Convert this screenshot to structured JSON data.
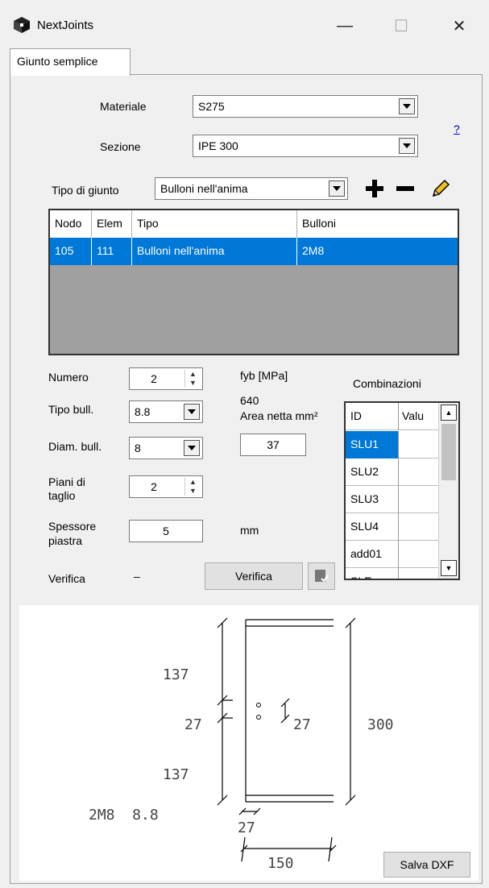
{
  "window": {
    "title": "NextJoints",
    "minimize": "—",
    "maximize": "☐",
    "close": "✕"
  },
  "tab": {
    "label": "Giunto semplice"
  },
  "form": {
    "materiale_label": "Materiale",
    "materiale_value": "S275",
    "sezione_label": "Sezione",
    "sezione_value": "IPE 300",
    "help_link": "?",
    "tipo_giunto_label": "Tipo di giunto",
    "tipo_giunto_value": "Bulloni nell'anima"
  },
  "grid": {
    "headers": [
      "Nodo",
      "Elem",
      "Tipo",
      "Bulloni"
    ],
    "rows": [
      [
        "105",
        "111",
        "Bulloni nell'anima",
        "2M8"
      ]
    ]
  },
  "bolts": {
    "numero_label": "Numero",
    "numero_value": "2",
    "tipo_bull_label": "Tipo bull.",
    "tipo_bull_value": "8.8",
    "diam_bull_label": "Diam. bull.",
    "diam_bull_value": "8",
    "piani_label_1": "Piani di",
    "piani_label_2": "taglio",
    "piani_value": "2",
    "spessore_label_1": "Spessore",
    "spessore_label_2": "piastra",
    "spessore_value": "5",
    "mm_label": "mm",
    "fyb_label": "fyb [MPa]",
    "fyb_value": "640",
    "area_label": "Area netta mm²",
    "area_value": "37",
    "verifica_label": "Verifica",
    "verifica_value": "–",
    "verifica_button": "Verifica"
  },
  "combinazioni": {
    "title": "Combinazioni",
    "headers": [
      "ID",
      "Valu"
    ],
    "rows": [
      "SLU1",
      "SLU2",
      "SLU3",
      "SLU4",
      "add01",
      "SLE"
    ],
    "selected": 0
  },
  "drawing": {
    "dim_top": "137",
    "dim_mid": "27",
    "dim_mid_right": "27",
    "dim_bottom": "137",
    "dim_height": "300",
    "bolt_spec": "2M8  8.8",
    "dim_web": "27",
    "dim_width": "150",
    "save_button": "Salva DXF"
  },
  "colors": {
    "accent": "#0078d7",
    "link": "#0000cc"
  }
}
